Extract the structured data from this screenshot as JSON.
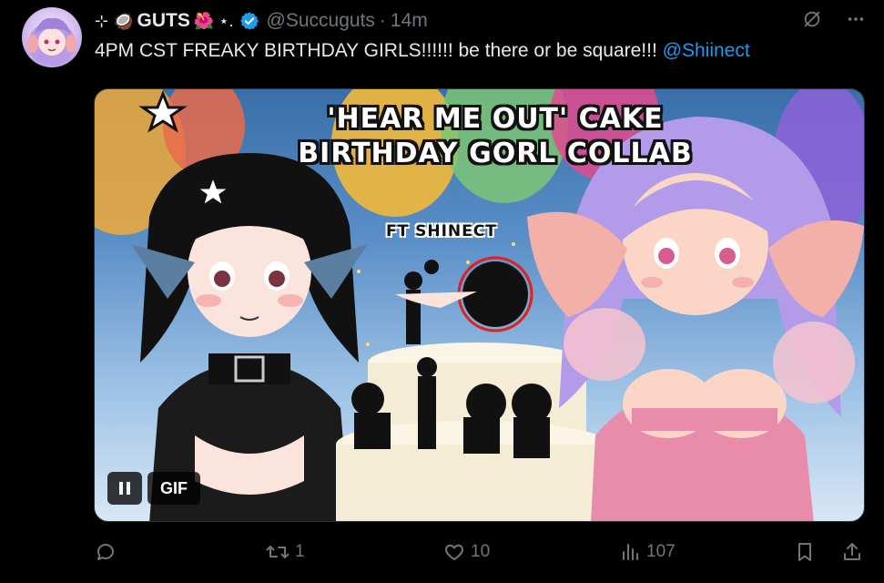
{
  "author": {
    "name_prefix": "⊹ 🥥",
    "display_name": "GUTS",
    "name_suffix": "🌺 ⋆.",
    "handle": "@Succuguts",
    "separator": "·",
    "timestamp": "14m",
    "verified": true
  },
  "tweet": {
    "text": "4PM CST FREAKY BIRTHDAY GIRLS!!!!!! be there or be square!!! ",
    "mention": "@Shiinect"
  },
  "media": {
    "title_line1": "'HEAR ME OUT' CAKE",
    "title_line2": "BIRTHDAY GORL COLLAB",
    "subtitle": "FT SHINECT",
    "badge": "GIF",
    "pause_icon": "pause-icon"
  },
  "actions": {
    "reply_count": "",
    "retweet_count": "1",
    "like_count": "10",
    "views_count": "107"
  },
  "colors": {
    "background": "#000000",
    "text": "#e7e9ea",
    "muted": "#71767b",
    "link": "#1d9bf0",
    "verified": "#1d9bf0"
  }
}
